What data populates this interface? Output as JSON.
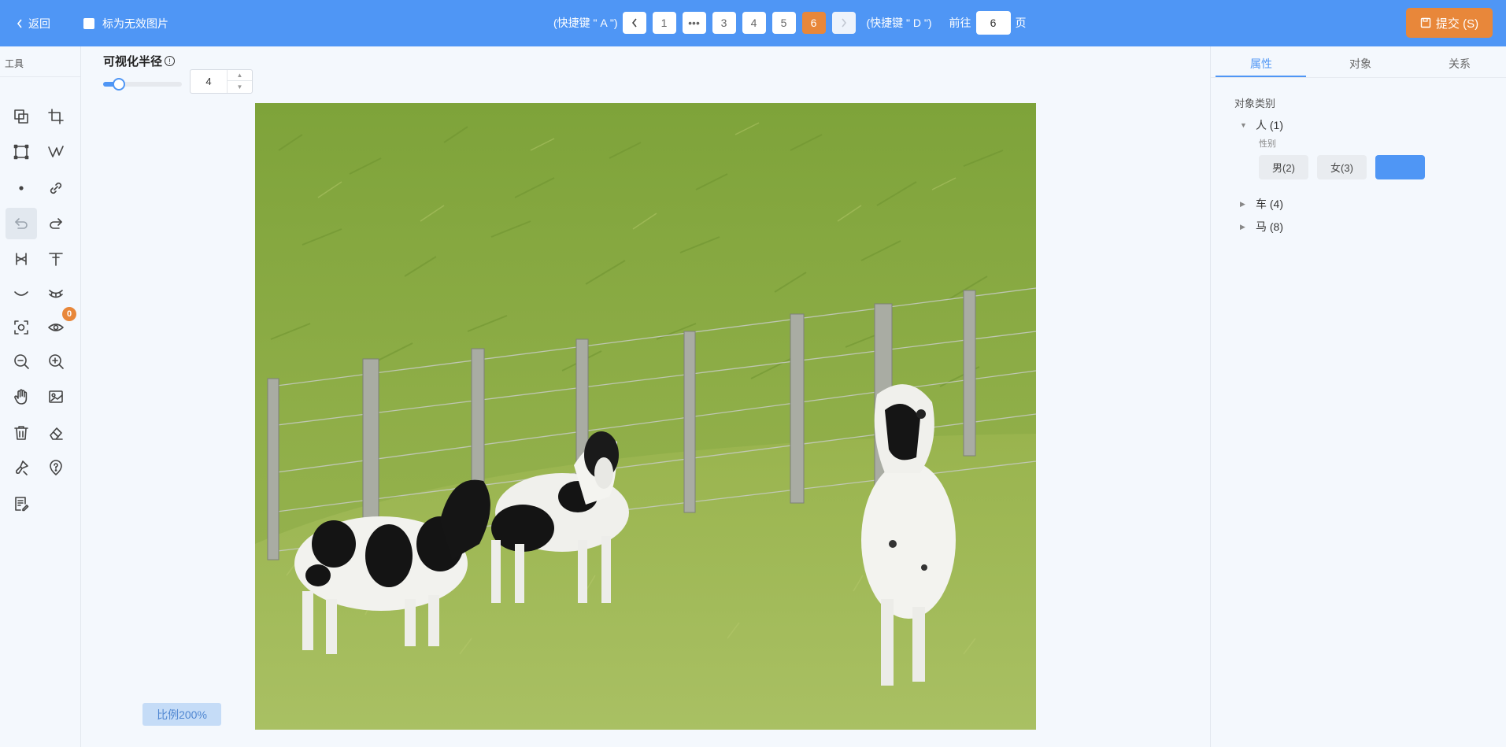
{
  "header": {
    "back_label": "返回",
    "invalid_label": "标为无效图片",
    "prev_hint": "(快捷键 \" A \")",
    "next_hint": "(快捷键 \" D \")",
    "pages": [
      "1",
      "•••",
      "3",
      "4",
      "5",
      "6"
    ],
    "current_page": "6",
    "goto_prefix": "前往",
    "goto_value": "6",
    "goto_suffix": "页",
    "submit_label": "提交 (S)"
  },
  "toolbar": {
    "label": "工具",
    "tools": [
      "copy-region-icon",
      "crop-icon",
      "rectangle-icon",
      "polyline-icon",
      "point-icon",
      "link-icon",
      "undo-icon",
      "redo-icon",
      "key-point-icon",
      "text-tool-icon",
      "curve-icon",
      "eyelash-icon",
      "focus-icon",
      "eye-icon",
      "zoom-out-icon",
      "zoom-in-icon",
      "hand-icon",
      "image-icon",
      "trash-icon",
      "eraser-icon",
      "brush-icon",
      "help-icon",
      "notes-icon"
    ],
    "eye_badge": "0"
  },
  "canvas": {
    "radius_label": "可视化半径",
    "radius_info": "!",
    "radius_value": "4",
    "slider_level": 0.2,
    "zoom_label": "比例200%"
  },
  "panel": {
    "tabs": [
      "属性",
      "对象",
      "关系"
    ],
    "active_tab": "属性",
    "object_category_title": "对象类别",
    "categories": [
      {
        "label": "人 (1)",
        "expanded": true
      },
      {
        "label": "车 (4)",
        "expanded": false
      },
      {
        "label": "马 (8)",
        "expanded": false
      }
    ],
    "gender_label": "性别",
    "gender_options": [
      "男(2)",
      "女(3)",
      ""
    ]
  },
  "colors": {
    "header_blue": "#4f96f5",
    "accent_orange": "#e8873a",
    "grass_green": "#84a83e"
  }
}
